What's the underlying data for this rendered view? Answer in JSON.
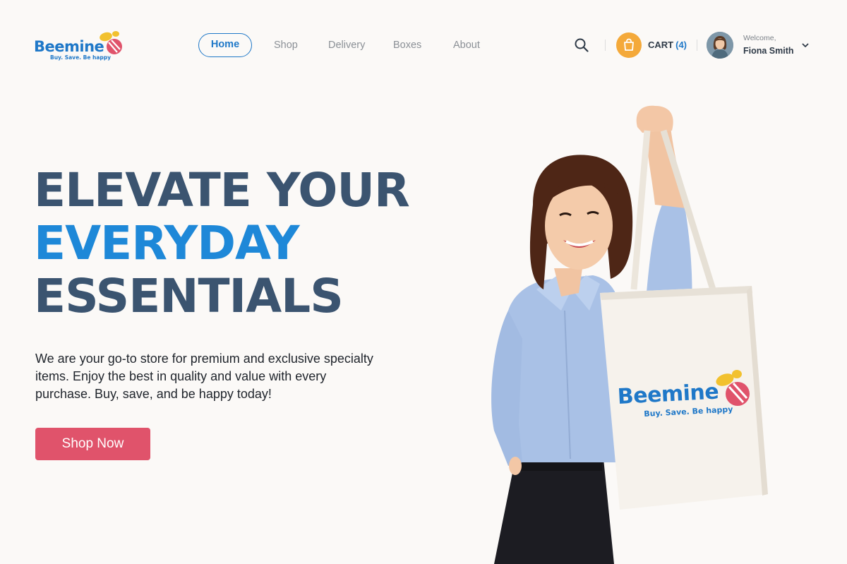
{
  "brand": {
    "name": "Beemine",
    "tagline": "Buy. Save. Be happy",
    "colors": {
      "blue": "#1f78c8",
      "red": "#e0536b",
      "yellow": "#f2c12e"
    }
  },
  "nav": {
    "items": [
      {
        "label": "Home",
        "active": true
      },
      {
        "label": "Shop",
        "active": false
      },
      {
        "label": "Delivery",
        "active": false
      },
      {
        "label": "Boxes",
        "active": false
      },
      {
        "label": "About",
        "active": false
      }
    ]
  },
  "header": {
    "search_icon": "search-icon",
    "cart": {
      "label": "CART",
      "count": "(4)",
      "icon": "shopping-bag-icon"
    },
    "user": {
      "welcome": "Welcome,",
      "name": "Fiona Smith"
    }
  },
  "hero": {
    "headline_line1": "ELEVATE YOUR",
    "headline_line2": "EVERYDAY",
    "headline_line3": "ESSENTIALS",
    "description": "We are your go-to store for premium and exclusive specialty items. Enjoy the best in quality and value with every purchase. Buy, save, and be happy today!",
    "cta_label": "Shop Now"
  },
  "colors": {
    "background": "#fbf9f7",
    "headline_dark": "#3b5470",
    "headline_accent": "#1e88d8",
    "cta": "#e0536b",
    "cart_badge": "#f4a93a"
  }
}
